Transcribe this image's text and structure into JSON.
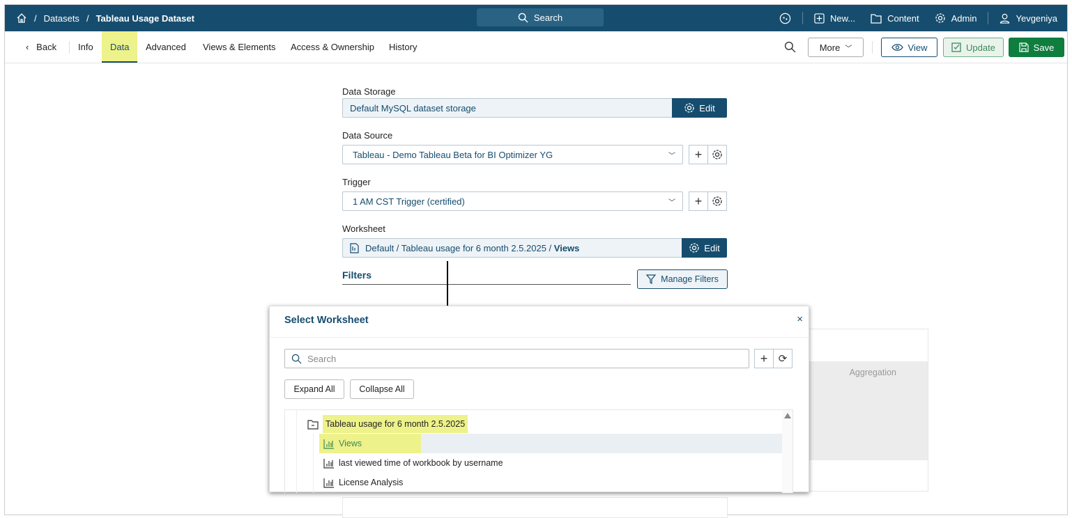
{
  "breadcrumb": {
    "home": "home-icon",
    "items": [
      "Datasets",
      "Tableau Usage Dataset"
    ]
  },
  "global_search": "Search",
  "top_right": {
    "new": "New...",
    "content": "Content",
    "admin": "Admin",
    "user": "Yevgeniya"
  },
  "tabs": {
    "back": "Back",
    "items": [
      "Info",
      "Data",
      "Advanced",
      "Views & Elements",
      "Access & Ownership",
      "History"
    ],
    "active": "Data"
  },
  "toolbar": {
    "more": "More",
    "view": "View",
    "update": "Update",
    "save": "Save"
  },
  "form": {
    "data_storage": {
      "label": "Data Storage",
      "value": "Default MySQL dataset storage",
      "edit": "Edit"
    },
    "data_source": {
      "label": "Data Source",
      "value": "Tableau - Demo Tableau Beta for BI Optimizer YG"
    },
    "trigger": {
      "label": "Trigger",
      "value": "1 AM CST Trigger (certified)"
    },
    "worksheet": {
      "label": "Worksheet",
      "value_prefix": "Default / Tableau usage for 6 month 2.5.2025 / ",
      "value_bold": "Views",
      "edit": "Edit"
    },
    "filters": {
      "label": "Filters",
      "manage": "Manage Filters"
    }
  },
  "background": {
    "aggregation": "Aggregation"
  },
  "modal": {
    "title": "Select Worksheet",
    "search_placeholder": "Search",
    "expand_all": "Expand All",
    "collapse_all": "Collapse All",
    "tree": {
      "folder": "Tableau usage for 6 month 2.5.2025",
      "items": [
        "Views",
        "last viewed time of workbook by username",
        "License Analysis"
      ],
      "selected": "Views"
    }
  },
  "colors": {
    "brand": "#164d6e",
    "save": "#0f7d3e",
    "highlight": "#eef28a"
  }
}
